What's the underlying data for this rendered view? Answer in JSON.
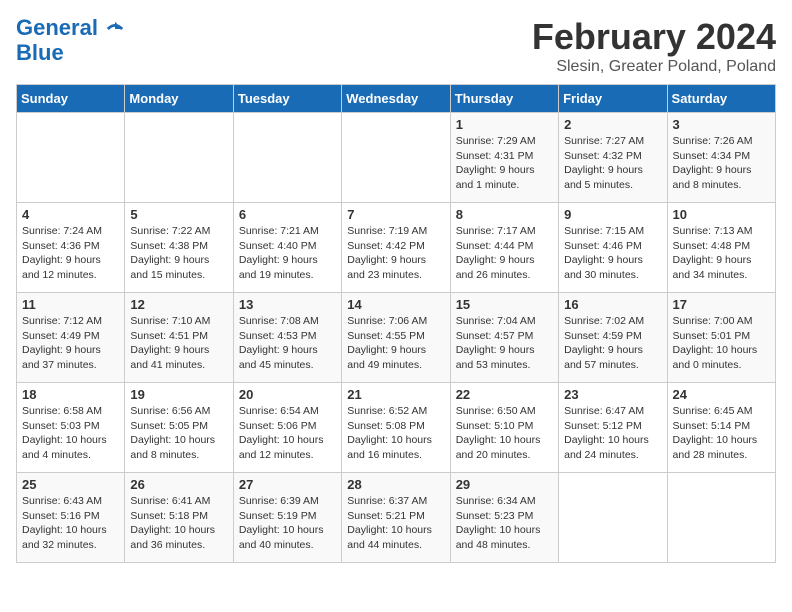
{
  "header": {
    "logo_line1": "General",
    "logo_line2": "Blue",
    "title": "February 2024",
    "subtitle": "Slesin, Greater Poland, Poland"
  },
  "weekdays": [
    "Sunday",
    "Monday",
    "Tuesday",
    "Wednesday",
    "Thursday",
    "Friday",
    "Saturday"
  ],
  "weeks": [
    [
      {
        "day": "",
        "info": ""
      },
      {
        "day": "",
        "info": ""
      },
      {
        "day": "",
        "info": ""
      },
      {
        "day": "",
        "info": ""
      },
      {
        "day": "1",
        "info": "Sunrise: 7:29 AM\nSunset: 4:31 PM\nDaylight: 9 hours\nand 1 minute."
      },
      {
        "day": "2",
        "info": "Sunrise: 7:27 AM\nSunset: 4:32 PM\nDaylight: 9 hours\nand 5 minutes."
      },
      {
        "day": "3",
        "info": "Sunrise: 7:26 AM\nSunset: 4:34 PM\nDaylight: 9 hours\nand 8 minutes."
      }
    ],
    [
      {
        "day": "4",
        "info": "Sunrise: 7:24 AM\nSunset: 4:36 PM\nDaylight: 9 hours\nand 12 minutes."
      },
      {
        "day": "5",
        "info": "Sunrise: 7:22 AM\nSunset: 4:38 PM\nDaylight: 9 hours\nand 15 minutes."
      },
      {
        "day": "6",
        "info": "Sunrise: 7:21 AM\nSunset: 4:40 PM\nDaylight: 9 hours\nand 19 minutes."
      },
      {
        "day": "7",
        "info": "Sunrise: 7:19 AM\nSunset: 4:42 PM\nDaylight: 9 hours\nand 23 minutes."
      },
      {
        "day": "8",
        "info": "Sunrise: 7:17 AM\nSunset: 4:44 PM\nDaylight: 9 hours\nand 26 minutes."
      },
      {
        "day": "9",
        "info": "Sunrise: 7:15 AM\nSunset: 4:46 PM\nDaylight: 9 hours\nand 30 minutes."
      },
      {
        "day": "10",
        "info": "Sunrise: 7:13 AM\nSunset: 4:48 PM\nDaylight: 9 hours\nand 34 minutes."
      }
    ],
    [
      {
        "day": "11",
        "info": "Sunrise: 7:12 AM\nSunset: 4:49 PM\nDaylight: 9 hours\nand 37 minutes."
      },
      {
        "day": "12",
        "info": "Sunrise: 7:10 AM\nSunset: 4:51 PM\nDaylight: 9 hours\nand 41 minutes."
      },
      {
        "day": "13",
        "info": "Sunrise: 7:08 AM\nSunset: 4:53 PM\nDaylight: 9 hours\nand 45 minutes."
      },
      {
        "day": "14",
        "info": "Sunrise: 7:06 AM\nSunset: 4:55 PM\nDaylight: 9 hours\nand 49 minutes."
      },
      {
        "day": "15",
        "info": "Sunrise: 7:04 AM\nSunset: 4:57 PM\nDaylight: 9 hours\nand 53 minutes."
      },
      {
        "day": "16",
        "info": "Sunrise: 7:02 AM\nSunset: 4:59 PM\nDaylight: 9 hours\nand 57 minutes."
      },
      {
        "day": "17",
        "info": "Sunrise: 7:00 AM\nSunset: 5:01 PM\nDaylight: 10 hours\nand 0 minutes."
      }
    ],
    [
      {
        "day": "18",
        "info": "Sunrise: 6:58 AM\nSunset: 5:03 PM\nDaylight: 10 hours\nand 4 minutes."
      },
      {
        "day": "19",
        "info": "Sunrise: 6:56 AM\nSunset: 5:05 PM\nDaylight: 10 hours\nand 8 minutes."
      },
      {
        "day": "20",
        "info": "Sunrise: 6:54 AM\nSunset: 5:06 PM\nDaylight: 10 hours\nand 12 minutes."
      },
      {
        "day": "21",
        "info": "Sunrise: 6:52 AM\nSunset: 5:08 PM\nDaylight: 10 hours\nand 16 minutes."
      },
      {
        "day": "22",
        "info": "Sunrise: 6:50 AM\nSunset: 5:10 PM\nDaylight: 10 hours\nand 20 minutes."
      },
      {
        "day": "23",
        "info": "Sunrise: 6:47 AM\nSunset: 5:12 PM\nDaylight: 10 hours\nand 24 minutes."
      },
      {
        "day": "24",
        "info": "Sunrise: 6:45 AM\nSunset: 5:14 PM\nDaylight: 10 hours\nand 28 minutes."
      }
    ],
    [
      {
        "day": "25",
        "info": "Sunrise: 6:43 AM\nSunset: 5:16 PM\nDaylight: 10 hours\nand 32 minutes."
      },
      {
        "day": "26",
        "info": "Sunrise: 6:41 AM\nSunset: 5:18 PM\nDaylight: 10 hours\nand 36 minutes."
      },
      {
        "day": "27",
        "info": "Sunrise: 6:39 AM\nSunset: 5:19 PM\nDaylight: 10 hours\nand 40 minutes."
      },
      {
        "day": "28",
        "info": "Sunrise: 6:37 AM\nSunset: 5:21 PM\nDaylight: 10 hours\nand 44 minutes."
      },
      {
        "day": "29",
        "info": "Sunrise: 6:34 AM\nSunset: 5:23 PM\nDaylight: 10 hours\nand 48 minutes."
      },
      {
        "day": "",
        "info": ""
      },
      {
        "day": "",
        "info": ""
      }
    ]
  ]
}
